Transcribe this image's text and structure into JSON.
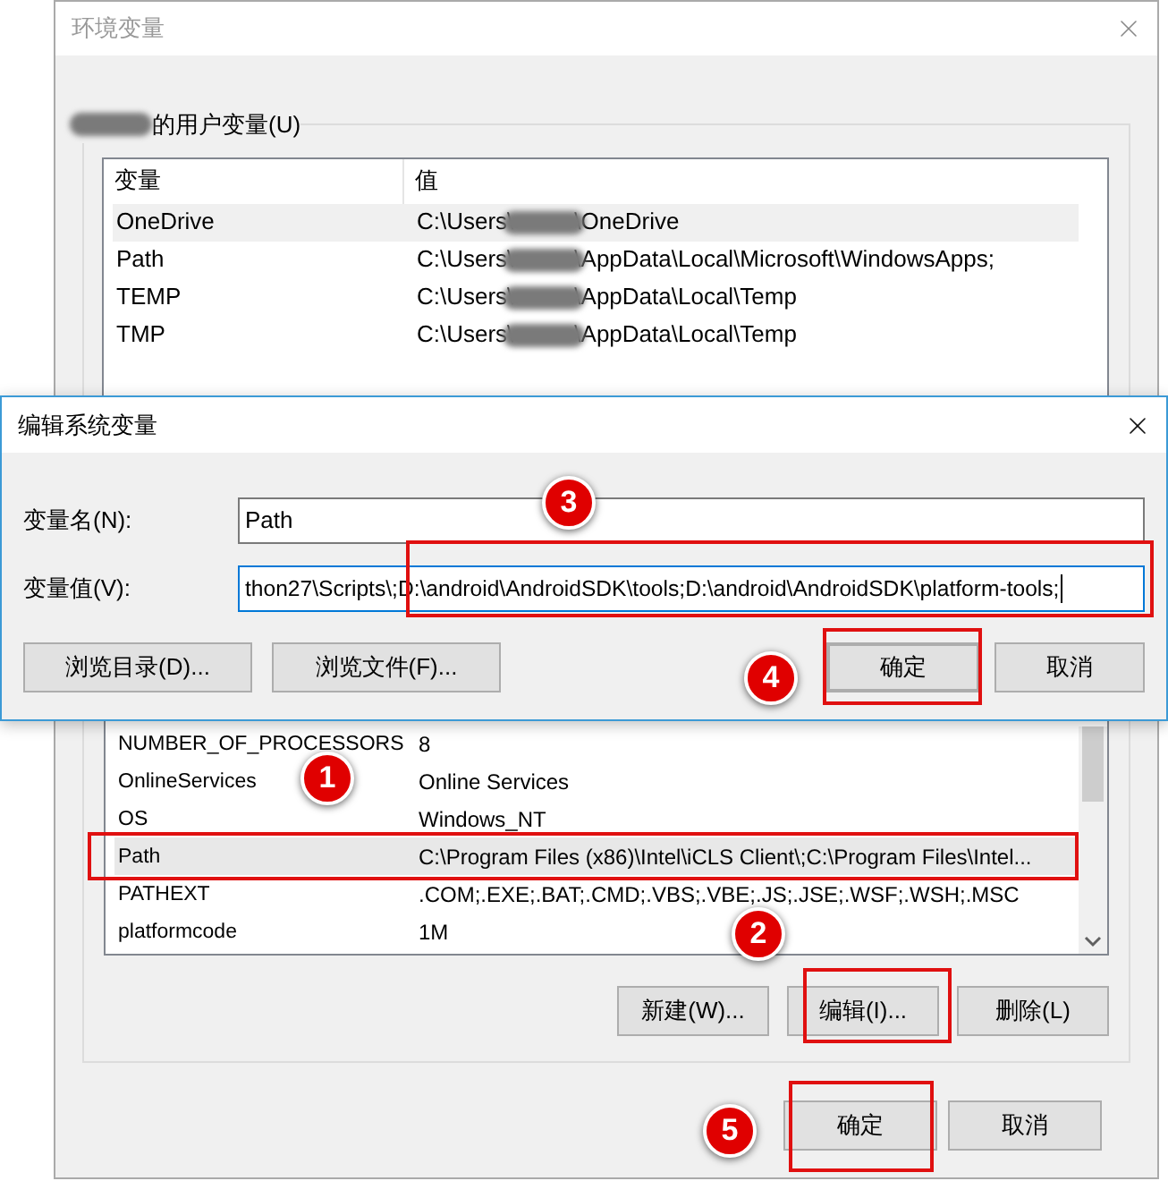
{
  "env_window": {
    "title": "环境变量",
    "user_group": {
      "label": "的用户变量(U)",
      "columns": [
        "变量",
        "值"
      ],
      "rows": [
        {
          "name": "OneDrive",
          "value_start": "C:\\Users\\",
          "value_end": "\\OneDrive",
          "selected": true
        },
        {
          "name": "Path",
          "value_start": "C:\\Users\\",
          "value_end": "\\AppData\\Local\\Microsoft\\WindowsApps;",
          "selected": false
        },
        {
          "name": "TEMP",
          "value_start": "C:\\Users\\",
          "value_end": "\\AppData\\Local\\Temp",
          "selected": false
        },
        {
          "name": "TMP",
          "value_start": "C:\\Users\\",
          "value_end": "\\AppData\\Local\\Temp",
          "selected": false
        }
      ]
    },
    "system_group": {
      "rows": [
        {
          "name": "NUMBER_OF_PROCESSORS",
          "value": "8",
          "selected": false
        },
        {
          "name": "OnlineServices",
          "value": "Online Services",
          "selected": false
        },
        {
          "name": "OS",
          "value": "Windows_NT",
          "selected": false
        },
        {
          "name": "Path",
          "value": "C:\\Program Files (x86)\\Intel\\iCLS Client\\;C:\\Program Files\\Intel...",
          "selected": true
        },
        {
          "name": "PATHEXT",
          "value": ".COM;.EXE;.BAT;.CMD;.VBS;.VBE;.JS;.JSE;.WSF;.WSH;.MSC",
          "selected": false
        },
        {
          "name": "platformcode",
          "value": "1M",
          "selected": false
        }
      ],
      "buttons": [
        "新建(W)...",
        "编辑(I)...",
        "删除(L)"
      ]
    },
    "buttons": [
      "确定",
      "取消"
    ]
  },
  "edit_dialog": {
    "title": "编辑系统变量",
    "fields": [
      {
        "label": "变量名(N):",
        "value": "Path",
        "focused": false
      },
      {
        "label": "变量值(V):",
        "value": "thon27\\Scripts\\;D:\\android\\AndroidSDK\\tools;D:\\android\\AndroidSDK\\platform-tools;",
        "focused": true
      }
    ],
    "left_buttons": [
      "浏览目录(D)...",
      "浏览文件(F)..."
    ],
    "buttons": [
      {
        "label": "确定",
        "default": true
      },
      {
        "label": "取消",
        "default": false
      }
    ]
  },
  "annotations": [
    {
      "label": "1"
    },
    {
      "label": "2"
    },
    {
      "label": "3"
    },
    {
      "label": "4"
    },
    {
      "label": "5"
    }
  ]
}
